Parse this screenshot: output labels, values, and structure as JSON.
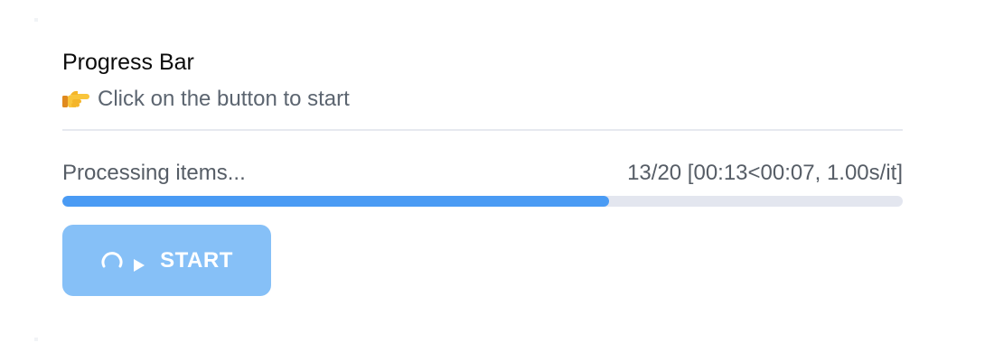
{
  "panel": {
    "title": "Progress Bar",
    "subtitle": "Click on the button to start",
    "subtitle_icon": "pointing-right-hand-icon"
  },
  "progress": {
    "label": "Processing items...",
    "stats": "13/20 [00:13<00:07, 1.00s/it]",
    "current": 13,
    "total": 20,
    "fraction": 0.65
  },
  "start_button": {
    "label": "START",
    "icons": [
      "spinner-icon",
      "play-icon"
    ],
    "state": "loading"
  },
  "colors": {
    "progress_fill": "#4a9bf4",
    "progress_track": "#e3e6ef",
    "button_background": "#86c0f7",
    "title_text": "#0b0b0b",
    "muted_text": "#5c6570"
  }
}
